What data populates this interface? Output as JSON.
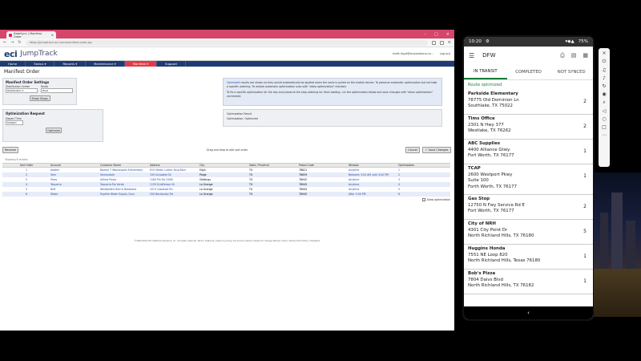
{
  "browser": {
    "tab_title": "DataSync | Manifest Order",
    "url": "https://jumptrack.eci.com/manifest-order.jsp",
    "user": "brett.lloyd@ecisolutions.co...",
    "logout": "Log out"
  },
  "app": {
    "logo": "eci",
    "product": "JumpTrack",
    "nav": [
      "Home",
      "Status ▾",
      "Reports ▾",
      "Maintenance ▾",
      "Manifest ▾",
      "Support"
    ],
    "page_title": "Manifest Order"
  },
  "settings": {
    "heading": "Manifest Order Settings",
    "dist_label": "Distribution Center",
    "dist_value": "Distribution 1",
    "route_label": "Route",
    "route_value": "Dual",
    "show_stops": "Show Stops"
  },
  "opt_request": {
    "heading": "Optimization Request",
    "depart_label": "Depart Time",
    "depart_value": "8:00am",
    "button": "Optimize"
  },
  "info": {
    "strong": "Optimized",
    "line1": " results are shown as they would automatically be applied when the route is pulled on the mobile device. To preserve automatic optimization but not take a specific ordering. To restore automatic optimization uses with \"allow optimization\" checked.",
    "line2": "To fix a specific optimization for the day and preserve the stop ordering for fresh loading, run the optimization below and save changes with \"allow optimization\" unchecked."
  },
  "opt_result": {
    "heading": "Optimization Result",
    "label": "Optimization:",
    "value": "Optimized"
  },
  "toolbar": {
    "reverse": "Reverse",
    "hint": "Drag and drop to edit sort order",
    "cancel": "Cancel",
    "save": "✓ Save Changes",
    "showing": "Showing 6 entries"
  },
  "table": {
    "headers": [
      "Sort Order",
      "Account",
      "Customer Name",
      "Address",
      "City",
      "State / Province",
      "Postal Code",
      "Window",
      "Optimization"
    ],
    "rows": [
      [
        "1",
        "booker",
        "Booker T Washington Elementary",
        "615 Martin Luther King Blvd",
        "Elgin",
        "TX",
        "78621",
        "Anytime",
        "1"
      ],
      [
        "2",
        "Vern",
        "Vernondale",
        "150 Dunsable Dr",
        "Paige",
        "TX",
        "78659",
        "Between 3:00 AM until 4:00 PM",
        "2"
      ],
      [
        "3",
        "Pizza",
        "Alfrest Pizzia",
        "1160 Pm Rd 2906",
        "Giddings",
        "TX",
        "78942",
        "Anytime",
        "3"
      ],
      [
        "4",
        "Taqueria",
        "Taqueria Rio Verde",
        "1135 N Jefferson St",
        "La Grange",
        "TX",
        "78945",
        "Anytime",
        "4"
      ],
      [
        "5",
        "BnB",
        "Weidbrethe Bed & Breakfast",
        "1013 Goodnoll Rd",
        "La Grange",
        "TX",
        "78945",
        "Anytime",
        "5"
      ],
      [
        "6",
        "Water",
        "Fayette Water Supply Corp",
        "200 Bordovsky Rd",
        "La Grange",
        "TX",
        "78945",
        "After 3:00 PM",
        "6"
      ]
    ],
    "allow_opt": "Allow optimization"
  },
  "footer": "©2009-2023 ECI Software Solutions, Inc. All rights reserved. Terms. Features, support, pricing and service options subject to change without notice.    Status Information | Feedback",
  "phone": {
    "time": "10:20",
    "battery": "75%",
    "title": "DFW",
    "tabs": [
      "IN TRANSIT",
      "COMPLETED",
      "NOT SYNCED"
    ],
    "route_status": "Route optimized",
    "stops": [
      {
        "name": "Parkside Elementary",
        "addr1": "78775 Old Dominion Ln",
        "addr2": "Southlake, TX 75022",
        "count": "2"
      },
      {
        "name": "Tims Office",
        "addr1": "2301 N Hwy 377",
        "addr2": "Westlake, TX 76262",
        "count": "2"
      },
      {
        "name": "ABC Supplies",
        "addr1": "4400 Alliance Gtwy.",
        "addr2": "Fort Worth, TX 76177",
        "count": "1"
      },
      {
        "name": "TCAP",
        "addr1": "2600 Westport Pkwy",
        "addr2": "Suite 100",
        "addr3": "Forth Worth, TX 76177",
        "count": "1"
      },
      {
        "name": "Gas Stop",
        "addr1": "12750 N Fwy Service Rd E",
        "addr2": "Fort Worth, TX 76177",
        "count": "2"
      },
      {
        "name": "City of NRH",
        "addr1": "4301 City Point Dr",
        "addr2": "North Richland Hills, TX 76180",
        "count": "5"
      },
      {
        "name": "Huggins Honda",
        "addr1": "7551 NE Loop 820",
        "addr2": "North Richland Hills, Texas 76180",
        "count": "1"
      },
      {
        "name": "Bob's Pizza",
        "addr1": "7804 Daivs Blvd",
        "addr2": "North Richland Hills, TX 76182",
        "count": "1"
      }
    ]
  }
}
